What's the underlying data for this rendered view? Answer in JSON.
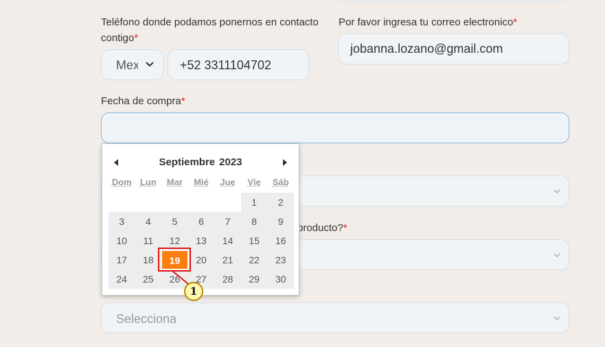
{
  "form": {
    "phone_label": "Teléfono donde podamos ponernos en contacto",
    "phone_label_line2": "contigo",
    "required_mark": "*",
    "country_value": "Mex",
    "phone_value": "+52 3311104702",
    "email_label": "Por favor ingresa tu correo electronico",
    "email_value": "jobanna.lozano@gmail.com",
    "date_label": "Fecha de compra",
    "date_value": "",
    "question2_label_visible": "producto?",
    "select3_placeholder": "Selecciona"
  },
  "calendar": {
    "month": "Septiembre",
    "year": "2023",
    "weekdays": [
      "Dom",
      "Lun",
      "Mar",
      "Mié",
      "Jue",
      "Vie",
      "Sáb"
    ],
    "weeks": [
      [
        "",
        "",
        "",
        "",
        "",
        "1",
        "2"
      ],
      [
        "3",
        "4",
        "5",
        "6",
        "7",
        "8",
        "9"
      ],
      [
        "10",
        "11",
        "12",
        "13",
        "14",
        "15",
        "16"
      ],
      [
        "17",
        "18",
        "19",
        "20",
        "21",
        "22",
        "23"
      ],
      [
        "24",
        "25",
        "26",
        "27",
        "28",
        "29",
        "30"
      ]
    ],
    "selected_day": "19"
  },
  "annotation": {
    "marker_label": "1"
  },
  "colors": {
    "background": "#f2ede8",
    "field_bg": "#f1f4f7",
    "selected_day_bg": "#fb7e0f",
    "required_red": "#e02020",
    "highlight_red": "#e01010"
  }
}
